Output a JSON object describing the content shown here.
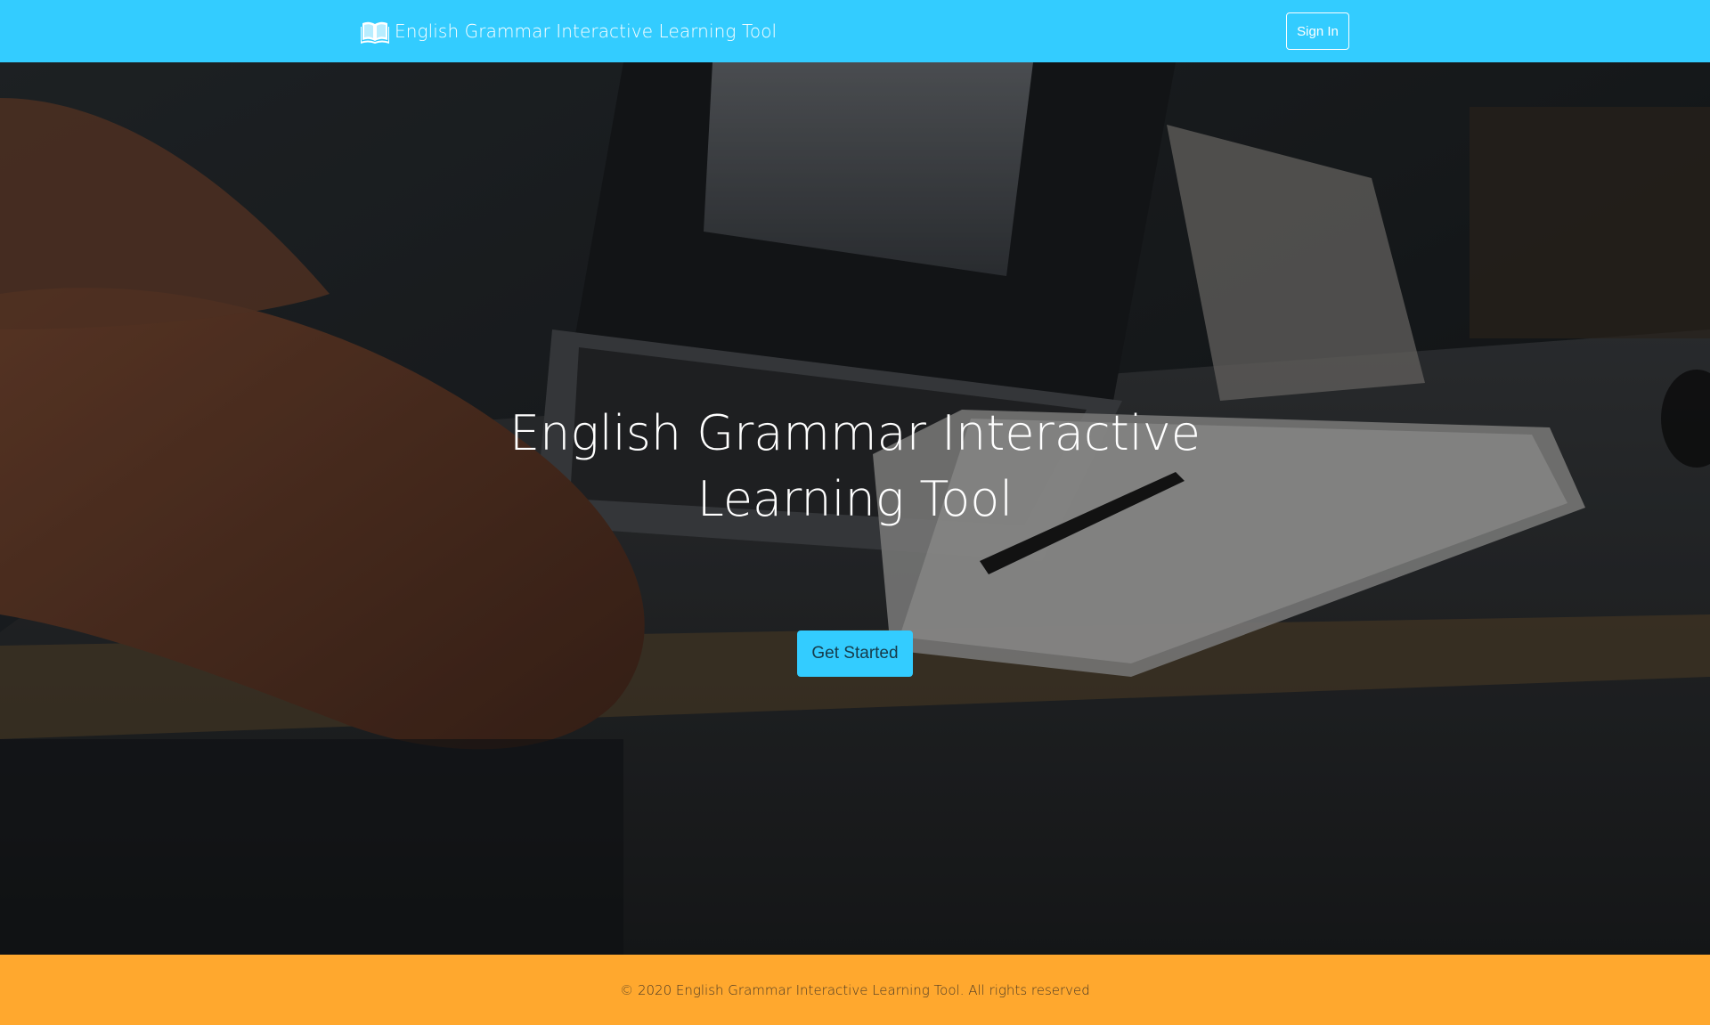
{
  "colors": {
    "navbar": "#33ccff",
    "footer": "#ffa82e",
    "cta": "#33ccff"
  },
  "navbar": {
    "brand_icon": "open-book-icon",
    "brand_text": "English Grammar Interactive Learning Tool",
    "signin_label": "Sign In"
  },
  "hero": {
    "background": "laptop-desk-photo",
    "title_line1": "English Grammar Interactive",
    "title_line2": "Learning Tool",
    "cta_label": "Get Started"
  },
  "footer": {
    "text": "© 2020 English Grammar Interactive Learning Tool. All rights reserved"
  }
}
